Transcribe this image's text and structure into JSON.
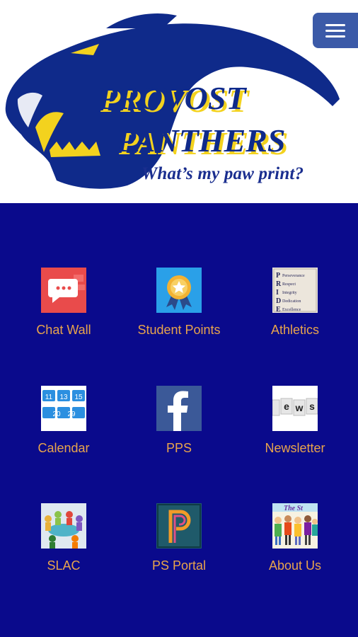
{
  "header": {
    "logo_text_line1": "PROVOST",
    "logo_text_line2": "PANTHERS",
    "tagline": "What’s my paw print?"
  },
  "menu": {
    "icon": "hamburger-icon"
  },
  "tiles": [
    {
      "label": "Chat Wall",
      "icon": "chat-wall-icon"
    },
    {
      "label": "Student Points",
      "icon": "award-badge-icon"
    },
    {
      "label": "Athletics",
      "icon": "pride-acronym-icon"
    },
    {
      "label": "Calendar",
      "icon": "calendar-icon"
    },
    {
      "label": "PPS",
      "icon": "facebook-icon"
    },
    {
      "label": "Newsletter",
      "icon": "news-tiles-icon"
    },
    {
      "label": "SLAC",
      "icon": "meeting-people-icon"
    },
    {
      "label": "PS Portal",
      "icon": "powerschool-icon"
    },
    {
      "label": "About Us",
      "icon": "kids-group-icon"
    }
  ],
  "calendar_numbers": [
    "11",
    "13",
    "15",
    "20",
    "29"
  ],
  "athletics_lines": [
    "Perseverance",
    "Respect",
    "Integrity",
    "Dedication",
    "Excellence"
  ],
  "news_letters": [
    "e",
    "w",
    "s"
  ],
  "colors": {
    "background": "#0a0a8c",
    "label": "#e8a44c",
    "logo_blue": "#1a2e8f",
    "logo_yellow": "#f3d21e"
  }
}
